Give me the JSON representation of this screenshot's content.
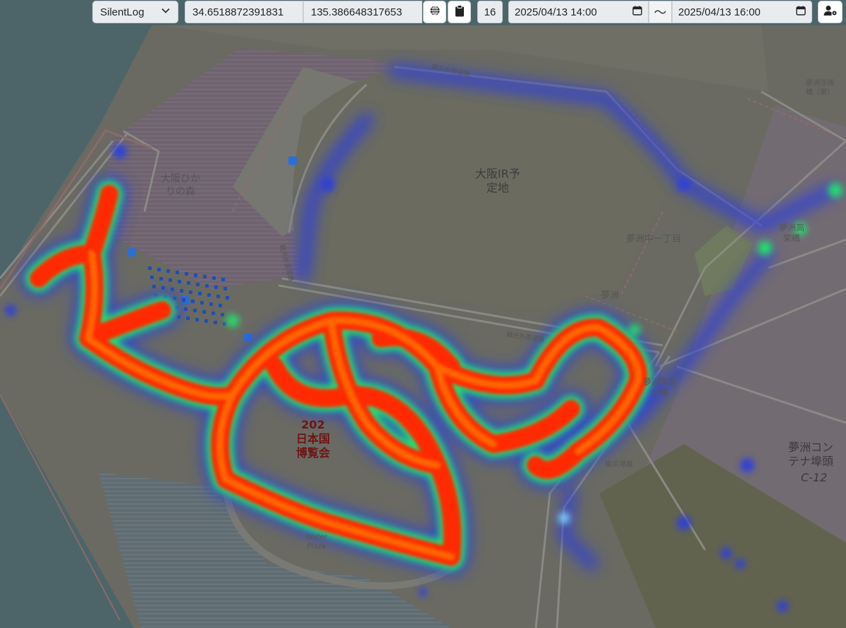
{
  "toolbar": {
    "source_select": "SilentLog",
    "latitude": "34.6518872391831",
    "longitude": "135.386648317653",
    "zoom": "16",
    "start_datetime": "2025/04/13 14:00",
    "separator": "〜",
    "end_datetime": "2025/04/13 16:00"
  },
  "icons": {
    "dropdown": "chevron-down-icon",
    "globe": "globe-icon",
    "clipboard": "clipboard-icon",
    "calendar": "calendar-icon",
    "user_settings": "user-gear-icon"
  },
  "map": {
    "labels": {
      "hikari_forest": "大阪ひか\nりの森",
      "ir_site": "大阪IR予\n定地",
      "yumeshima_chome": "夢洲中一丁目",
      "yumeshima": "夢洲",
      "expo": "202\n日本国\n博覧会",
      "container_terminal": "夢洲コン\nテナ埠頭",
      "c12": "C-12",
      "kanko_road_n": "観光外周道路",
      "kanko_road_w": "観光外周道路",
      "kanko_road_s": "観光外周道路",
      "south_bridge": "夢洲南高\n架橋",
      "yokohama": "横浜港展",
      "water_plaza": "Water\nPlaza",
      "east_bridge": "夢洲浮桟\n橋（東）",
      "north_bridge": "夢洲高\n架橋"
    },
    "colors": {
      "sea": "#4d6569",
      "land": "#6b6b62",
      "heat_low": "#2d3fd8",
      "heat_mid": "#22e070",
      "heat_high": "#ff2a00",
      "heat_core": "#ff6a00"
    }
  }
}
